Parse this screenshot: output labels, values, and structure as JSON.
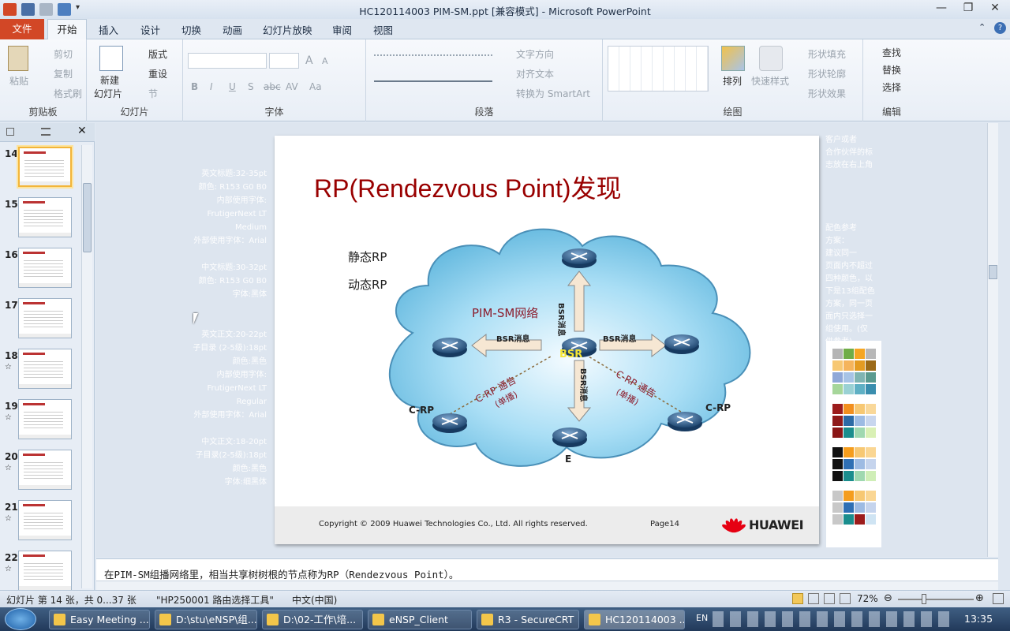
{
  "window": {
    "title": "HC120114003 PIM-SM.ppt [兼容模式]  -  Microsoft PowerPoint",
    "min": "—",
    "max": "❐",
    "close": "✕"
  },
  "tabs": {
    "file": "文件",
    "items": [
      "开始",
      "插入",
      "设计",
      "切换",
      "动画",
      "幻灯片放映",
      "审阅",
      "视图"
    ]
  },
  "ribbon": {
    "clipboard": {
      "paste": "粘贴",
      "cut": "剪切",
      "copy": "复制",
      "format_painter": "格式刷",
      "group": "剪贴板"
    },
    "slides": {
      "new_slide_1": "新建",
      "new_slide_2": "幻灯片",
      "layout": "版式",
      "reset": "重设",
      "section": "节",
      "group": "幻灯片"
    },
    "font": {
      "group": "字体",
      "bold": "B",
      "italic": "I",
      "underline": "U",
      "shadow": "S",
      "strike": "abc",
      "spacing": "AV",
      "case": "Aa",
      "grow": "A",
      "shrink": "A"
    },
    "paragraph": {
      "text_direction": "文字方向",
      "align_text": "对齐文本",
      "smartart": "转换为 SmartArt",
      "group": "段落"
    },
    "drawing": {
      "arrange": "排列",
      "quick_styles": "快速样式",
      "shape_fill": "形状填充",
      "shape_outline": "形状轮廓",
      "shape_effects": "形状效果",
      "group": "绘图"
    },
    "editing": {
      "find": "查找",
      "replace": "替换",
      "select": "选择",
      "group": "编辑"
    }
  },
  "thumbnails": [
    {
      "num": "14",
      "star": false
    },
    {
      "num": "15",
      "star": false
    },
    {
      "num": "16",
      "star": false
    },
    {
      "num": "17",
      "star": false
    },
    {
      "num": "18",
      "star": true
    },
    {
      "num": "19",
      "star": true
    },
    {
      "num": "20",
      "star": true
    },
    {
      "num": "21",
      "star": true
    },
    {
      "num": "22",
      "star": true
    }
  ],
  "side_notes_left": {
    "block1": [
      "英文标题:32-35pt",
      "颜色: R153 G0 B0",
      "内部使用字体:",
      "FrutigerNext LT",
      "Medium",
      "外部使用字体：Arial"
    ],
    "block2": [
      "中文标题:30-32pt",
      "颜色: R153 G0 B0",
      "字体:黑体"
    ],
    "block3": [
      "英文正文:20-22pt",
      "子目录 (2-5级):18pt",
      "颜色:黑色",
      "内部使用字体:",
      "FrutigerNext LT",
      "Regular",
      "外部使用字体：Arial"
    ],
    "block4": [
      "中文正文:18-20pt",
      "子目录(2-5级):18pt",
      "颜色:黑色",
      "字体:细黑体"
    ]
  },
  "side_notes_right": {
    "block1": [
      "客户或者",
      "合作伙伴的标",
      "志放在右上角"
    ],
    "block2": [
      "配色参考",
      "方案：",
      "建议同一",
      "页面内不超过",
      "四种颜色，以",
      "下是13组配色",
      "方案，同一页",
      "面内只选择一",
      "组使用。(仅",
      "供参考)"
    ]
  },
  "slide": {
    "title": "RP(Rendezvous Point)发现",
    "bullets": [
      "静态RP",
      "动态RP"
    ],
    "network_label": "PIM-SM网络",
    "bsr_msg": "BSR消息",
    "bsr": "BSR",
    "crp_notice": "C-RP 通告",
    "unicast": "(单播)",
    "crp": "C-RP",
    "e_label": "E",
    "copyright": "Copyright © 2009 Huawei Technologies Co., Ltd. All rights reserved.",
    "page": "Page14",
    "logo": "HUAWEI"
  },
  "colors": {
    "title": "#990000",
    "accent_file": "#d24726",
    "cloud": "#8fd0ef",
    "router": "#2c5a8a",
    "arrow": "#f2e3cf"
  },
  "notes_text": "在PIM-SM组播网络里，相当共享树树根的节点称为RP（Rendezvous Point）。",
  "status": {
    "slide_info": "幻灯片 第 14 张，共 0...37 张",
    "theme": "\"HP250001 路由选择工具\"",
    "lang": "中文(中国)",
    "zoom": "72%"
  },
  "taskbar": {
    "items": [
      "Easy Meeting ...",
      "D:\\stu\\eNSP\\组...",
      "D:\\02-工作\\培...",
      "eNSP_Client",
      "R3 - SecureCRT",
      "HC120114003 ..."
    ],
    "lang": "EN",
    "clock": "13:35"
  }
}
